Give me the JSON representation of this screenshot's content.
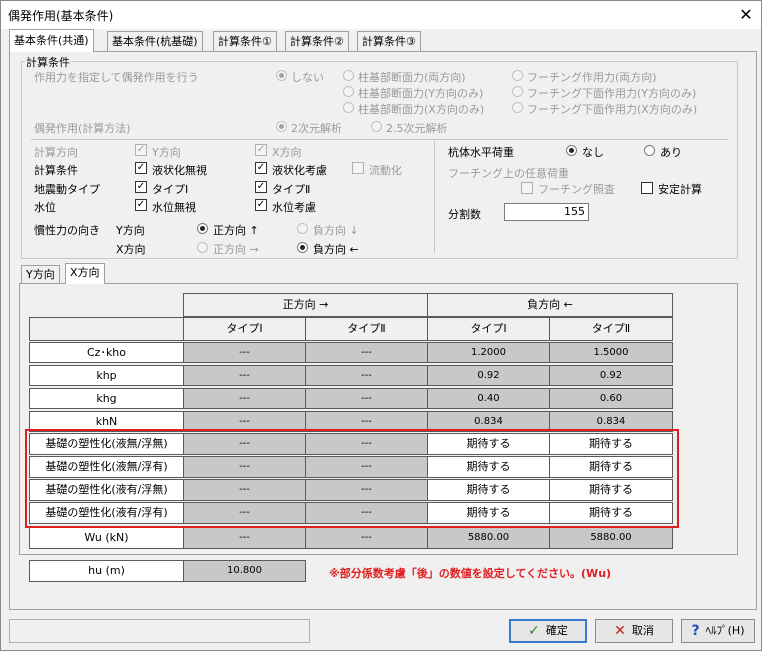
{
  "window": {
    "title": "偶発作用(基本条件)"
  },
  "tabs": [
    "基本条件(共通)",
    "基本条件(杭基礎)",
    "計算条件①",
    "計算条件②",
    "計算条件③"
  ],
  "calc_conditions": {
    "group_label": "計算条件",
    "specify_label": "作用力を指定して偶発作用を行う",
    "specify_options": [
      "しない",
      "柱基部断面力(両方向)",
      "柱基部断面力(Y方向のみ)",
      "柱基部断面力(X方向のみ)",
      "フーチング作用力(両方向)",
      "フーチング下面作用力(Y方向のみ)",
      "フーチング下面作用力(X方向のみ)"
    ],
    "method_label": "偶発作用(計算方法)",
    "method_options": [
      "2次元解析",
      "2.5次元解析"
    ],
    "direction_label": "計算方向",
    "dir_y": "Y方向",
    "dir_x": "X方向",
    "calc_cond_label": "計算条件",
    "liquefaction_ignore": "液状化無視",
    "liquefaction_consider": "液状化考慮",
    "flow": "流動化",
    "eq_type_label": "地震動タイプ",
    "type1": "タイプⅠ",
    "type2": "タイプⅡ",
    "water_label": "水位",
    "water_ignore": "水位無視",
    "water_consider": "水位考慮",
    "inertia_label": "慣性力の向き",
    "inertia_y": "Y方向",
    "inertia_x": "X方向",
    "positive": "正方向 ↑",
    "negative": "負方向 ↓",
    "positive_x": "正方向 →",
    "negative_x": "負方向 ←",
    "pile_load_label": "杭体水平荷重",
    "none": "なし",
    "exists": "あり",
    "footing_load_label": "フーチング上の任意荷重",
    "footing_check": "フーチング照査",
    "stability_calc": "安定計算",
    "divisions_label": "分割数",
    "divisions_value": "155"
  },
  "subtabs": [
    "Y方向",
    "X方向"
  ],
  "table": {
    "group_positive": "正方向 →",
    "group_negative": "負方向 ←",
    "col_headers": [
      "タイプⅠ",
      "タイプⅡ",
      "タイプⅠ",
      "タイプⅡ"
    ],
    "rows": [
      {
        "label": "Cz･kho",
        "values": [
          "---",
          "---",
          "1.2000",
          "1.5000"
        ]
      },
      {
        "label": "khp",
        "values": [
          "---",
          "---",
          "0.92",
          "0.92"
        ]
      },
      {
        "label": "khg",
        "values": [
          "---",
          "---",
          "0.40",
          "0.60"
        ]
      },
      {
        "label": "khN",
        "values": [
          "---",
          "---",
          "0.834",
          "0.834"
        ]
      },
      {
        "label": "基礎の塑性化(液無/浮無)",
        "values": [
          "---",
          "---",
          "期待する",
          "期待する"
        ]
      },
      {
        "label": "基礎の塑性化(液無/浮有)",
        "values": [
          "---",
          "---",
          "期待する",
          "期待する"
        ]
      },
      {
        "label": "基礎の塑性化(液有/浮無)",
        "values": [
          "---",
          "---",
          "期待する",
          "期待する"
        ]
      },
      {
        "label": "基礎の塑性化(液有/浮有)",
        "values": [
          "---",
          "---",
          "期待する",
          "期待する"
        ]
      },
      {
        "label": "Wu (kN)",
        "values": [
          "---",
          "---",
          "5880.00",
          "5880.00"
        ]
      }
    ],
    "hu_label": "hu (m)",
    "hu_value": "10.800",
    "warning": "※部分係数考慮「後」の数値を設定してください。(Wu)"
  },
  "buttons": {
    "ok": "確定",
    "cancel": "取消",
    "help": "ﾍﾙﾌﾟ(H)"
  },
  "colors": {
    "highlight": "#e02020",
    "gray_cell": "#c8c8c8"
  }
}
